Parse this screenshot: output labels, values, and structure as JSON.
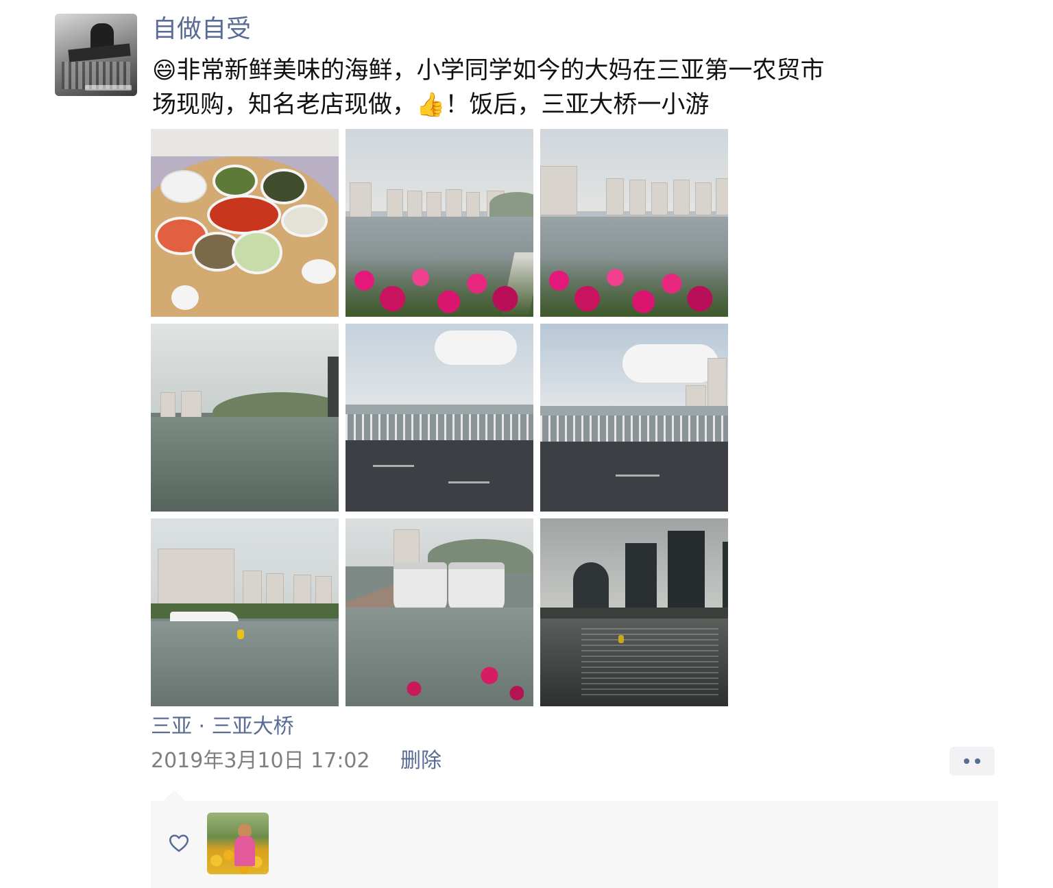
{
  "post": {
    "username": "自做自受",
    "text_line1": "非常新鲜美味的海鲜，小学同学如今的大妈在三亚第一农贸市",
    "text_line2_a": "场现购，知名老店现做，",
    "text_line2_b": "！饭后，三亚大桥一小游",
    "emoji_grin": "😄",
    "emoji_thumbs": "👍",
    "icon_grin": "grinning-face-emoji",
    "icon_thumbs": "thumbs-up-emoji",
    "photos": [
      {
        "subject": "seafood-dinner-table"
      },
      {
        "subject": "harbor-with-flowers"
      },
      {
        "subject": "harbor-with-flowers"
      },
      {
        "subject": "bay-and-hills"
      },
      {
        "subject": "bridge-road"
      },
      {
        "subject": "bridge-road"
      },
      {
        "subject": "bay-with-ferry"
      },
      {
        "subject": "docked-catamarans"
      },
      {
        "subject": "evening-towers"
      }
    ],
    "location": "三亚 · 三亚大桥",
    "timestamp": "2019年3月10日 17:02",
    "delete_label": "删除"
  },
  "colors": {
    "link": "#576b95",
    "text": "#111111",
    "meta": "#7f7f7f",
    "panel": "#f7f7f7"
  },
  "likes": {
    "icon": "heart-outline-icon",
    "count": 1
  }
}
